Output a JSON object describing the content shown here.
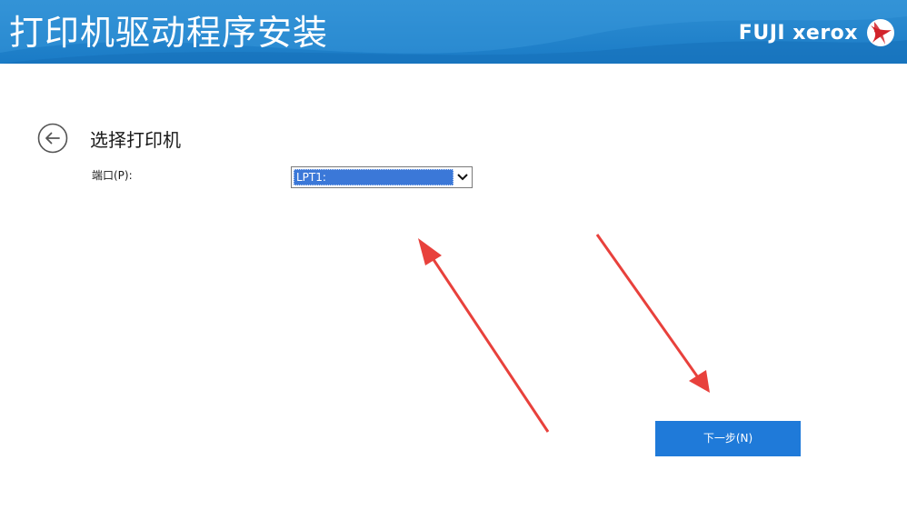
{
  "header": {
    "title": "打印机驱动程序安装",
    "brand": "FUJI xerox",
    "logo_icon": "fuji-xerox-logo-icon",
    "background_color": "#1a7bc6"
  },
  "back_button": {
    "icon": "arrow-left-circle-icon"
  },
  "main": {
    "section_title": "选择打印机",
    "port_label": "端口(P):",
    "port_select": {
      "selected_value": "LPT1:",
      "selection_color": "#3b78d8"
    }
  },
  "footer": {
    "next_label": "下一步(N)",
    "next_color": "#1f7ad9"
  },
  "annotations": {
    "arrow_color": "#e8413c"
  }
}
